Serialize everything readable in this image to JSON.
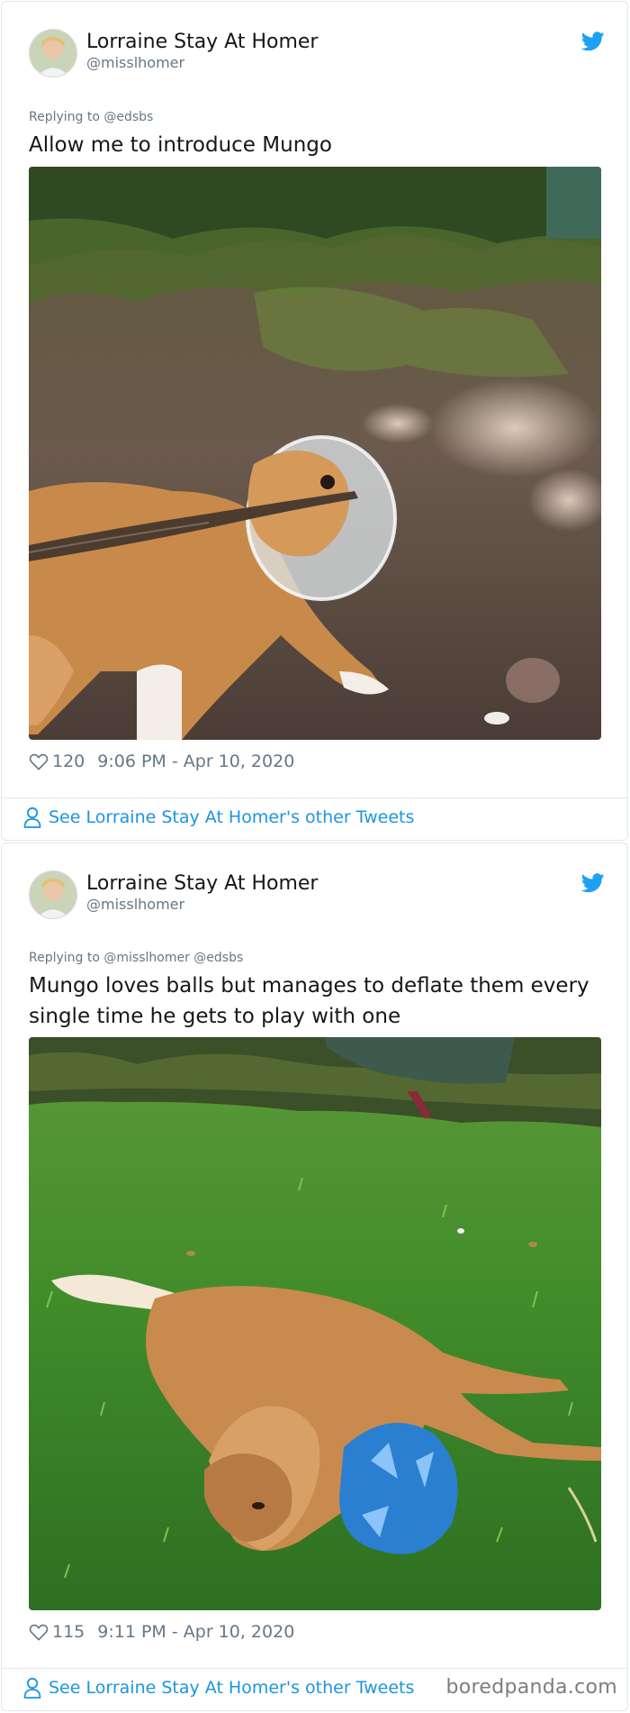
{
  "tweets": [
    {
      "author_name": "Lorraine Stay At Homer",
      "author_handle": "@misslhomer",
      "replying_to": "Replying to @edsbs",
      "text": "Allow me to introduce Mungo",
      "likes": "120",
      "timestamp": "9:06 PM - Apr 10, 2020",
      "other_tweets_link": "See Lorraine Stay At Homer's other Tweets"
    },
    {
      "author_name": "Lorraine Stay At Homer",
      "author_handle": "@misslhomer",
      "replying_to": "Replying to @misslhomer @edsbs",
      "text": "Mungo loves balls but manages to deflate them every single time he gets to play with one",
      "likes": "115",
      "timestamp": "9:11 PM - Apr 10, 2020",
      "other_tweets_link": "See Lorraine Stay At Homer's other Tweets"
    }
  ],
  "watermark": "boredpanda.com",
  "colors": {
    "twitter_blue": "#1da1f2",
    "link_blue": "#1b95e0",
    "muted_gray": "#657786",
    "border": "#e1e8ed"
  },
  "icons": [
    "twitter-bird-icon",
    "heart-icon",
    "person-icon"
  ]
}
